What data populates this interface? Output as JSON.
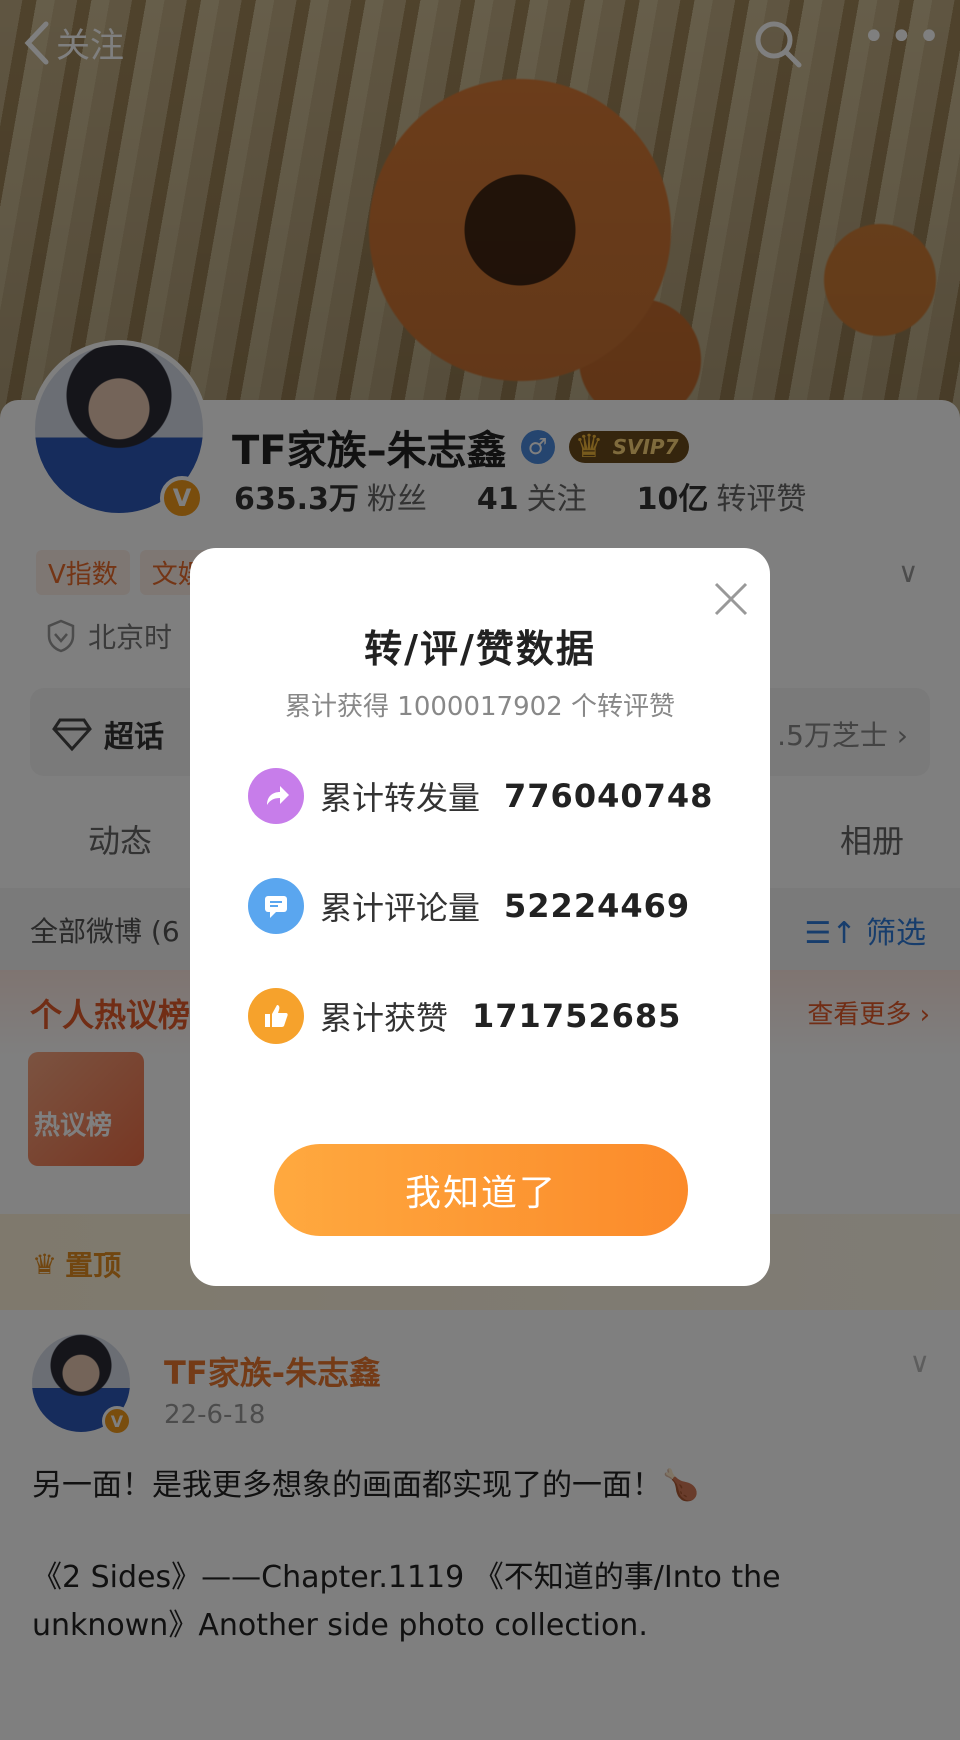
{
  "header": {
    "back_label": "关注"
  },
  "profile": {
    "name": "TF家族–朱志鑫",
    "vip_badge": "SVIP7",
    "verified_badge": "V",
    "stats": [
      {
        "value": "635.3万",
        "label": "粉丝"
      },
      {
        "value": "41",
        "label": "关注"
      },
      {
        "value": "10亿",
        "label": "转评赞"
      }
    ],
    "tags": [
      "V指数",
      "文娱"
    ],
    "location_partial": "北京时",
    "super_topic_label": "超话",
    "super_topic_right": ".5万芝士"
  },
  "tabs": [
    {
      "label": "动态"
    },
    {
      "label": "相册"
    }
  ],
  "feed": {
    "all_label": "全部微博 (6",
    "filter_label": "筛选",
    "hot_title": "个人热议榜",
    "hot_more": "查看更多",
    "hot_thumb_label": "热议榜",
    "pinned_label": "置顶"
  },
  "post": {
    "author": "TF家族-朱志鑫",
    "date": "22-6-18",
    "line1": "另一面！是我更多想象的画面都实现了的一面！🍗",
    "line2": "《2 Sides》——Chapter.1119 《不知道的事/Into the unknown》Another side photo collection."
  },
  "dialog": {
    "title": "转/评/赞数据",
    "subtitle": "累计获得 1000017902 个转评赞",
    "rows": [
      {
        "label": "累计转发量",
        "value": "776040748",
        "icon": "share-icon",
        "color": "#c77dea"
      },
      {
        "label": "累计评论量",
        "value": "52224469",
        "icon": "comment-icon",
        "color": "#5aa6ef"
      },
      {
        "label": "累计获赞",
        "value": "171752685",
        "icon": "thumbs-up-icon",
        "color": "#f6a22c"
      }
    ],
    "confirm_label": "我知道了"
  },
  "colors": {
    "accent_orange": "#fb8a2a",
    "link_blue": "#2f7ad8"
  }
}
